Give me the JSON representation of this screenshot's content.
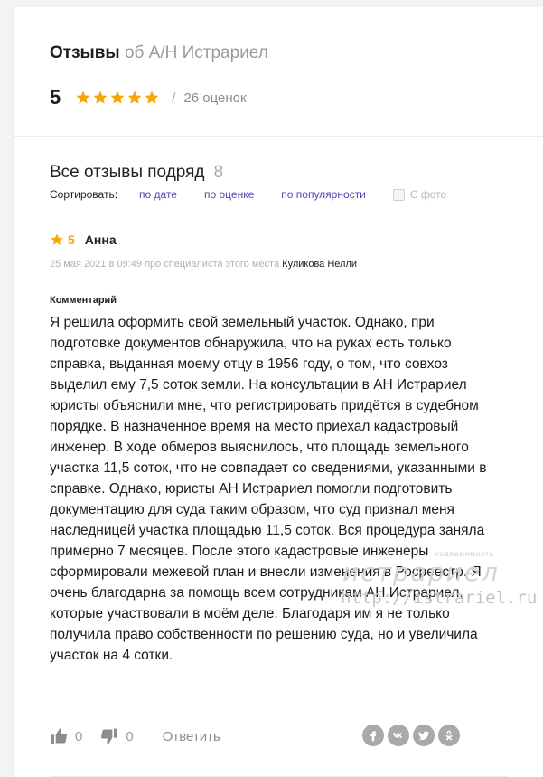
{
  "header": {
    "title_bold": "Отзывы",
    "title_rest": "об А/Н Истрариел",
    "rating": "5",
    "stars": 5,
    "slash": "/",
    "count_label": "26 оценок"
  },
  "list": {
    "title": "Все отзывы подряд",
    "total": "8",
    "sort_label": "Сортировать:",
    "sort_options": [
      "по дате",
      "по оценке",
      "по популярности"
    ],
    "photo_filter": "С фото"
  },
  "review": {
    "score": "5",
    "author": "Анна",
    "meta_text": "25 мая 2021 в 09:49 про специалиста этого места",
    "specialist": "Куликова Нелли",
    "comment_label": "Комментарий",
    "text": "Я решила оформить свой земельный участок. Однако, при подготовке документов обнаружила, что на руках есть только справка, выданная моему отцу в 1956 году, о том, что совхоз выделил ему 7,5 соток земли. На консультации в АН Истрариел юристы объяснили мне, что регистрировать придётся в судебном порядке. В назначенное время на место приехал кадастровый инженер. В ходе обмеров выяснилось, что площадь земельного участка 11,5 соток, что не совпадает со сведениями, указанными в справке. Однако, юристы АН Истрариел помогли подготовить документацию для суда таким образом, что суд признал меня наследницей участка площадью 11,5 соток. Вся процедура заняла примерно 7 месяцев. После этого кадастровые инженеры сформировали межевой план и внесли изменения в Росреестр. Я очень благодарна за помощь всем сотрудникам АН Истрариел, которые участвовали в моём деле. Благодаря им я не только получила право собственности по решению суда, но и увеличила участок на 4 сотки.",
    "likes": "0",
    "dislikes": "0",
    "reply_label": "Ответить"
  },
  "watermark": {
    "small": "недвижимость",
    "big": "истрариел",
    "url": "http://istrariel.ru"
  },
  "share_icons": [
    "facebook-icon",
    "vk-icon",
    "twitter-icon",
    "odnoklassniki-icon"
  ],
  "colors": {
    "star": "#f6a609",
    "link": "#5a3fb3",
    "icon_grey": "#a9a9a9"
  }
}
